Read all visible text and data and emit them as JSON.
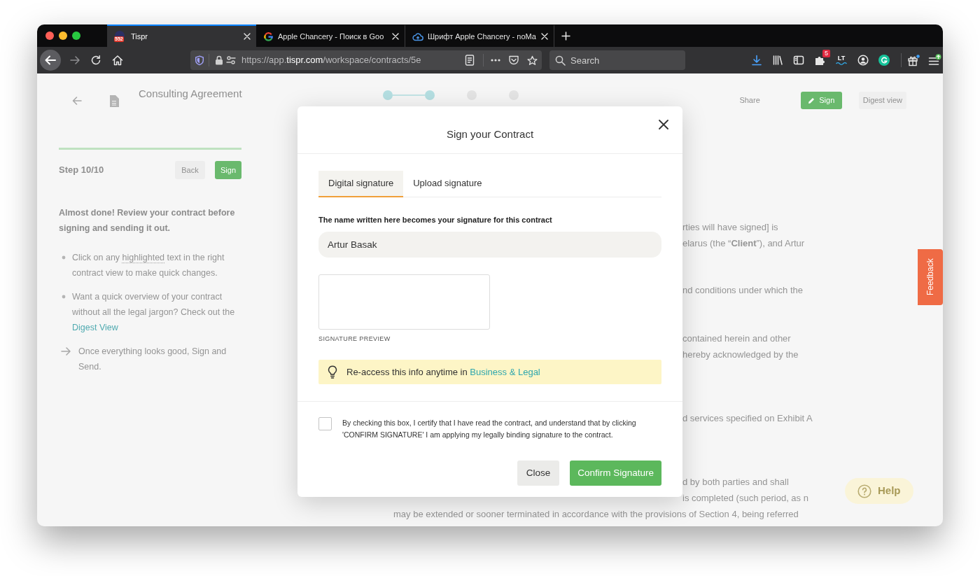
{
  "browser": {
    "tabs": [
      {
        "title": "Tispr",
        "kind": "badge",
        "badge": "552",
        "selected": true
      },
      {
        "title": "Apple Chancery - Поиск в Goo",
        "kind": "search",
        "selected": false
      },
      {
        "title": "Шрифт Apple Chancery - noMa",
        "kind": "cloud",
        "selected": false
      }
    ],
    "address": {
      "scheme": "https://app.",
      "domain": "tispr.com",
      "path": "/workspace/contracts/5e"
    },
    "search": {
      "placeholder": "Search"
    },
    "extensions": {
      "badge": "5",
      "label": "LT"
    }
  },
  "page": {
    "header": {
      "title": "Consulting Agreement",
      "steps": [
        {
          "completed": true
        },
        {
          "completed": true
        },
        {
          "completed": false
        },
        {
          "completed": false
        }
      ],
      "actions": [
        {
          "label": "Share",
          "kind": "plain"
        },
        {
          "label": "Sign",
          "kind": "primary"
        },
        {
          "label": "Digest view",
          "kind": "outline"
        }
      ]
    },
    "sidebar": {
      "progress": {
        "level": 1
      },
      "step": "Step 10/10",
      "buttons": [
        {
          "label": "Back",
          "kind": "secondary"
        },
        {
          "label": "Sign",
          "kind": "primary"
        }
      ],
      "intro": "Almost done! Review your contract before signing and sending it out.",
      "tips": [
        {
          "kind": "bullet",
          "parts": [
            {
              "kind": "plain",
              "text": "Click on any "
            },
            {
              "kind": "highlight",
              "text": "highlighted"
            },
            {
              "kind": "plain",
              "text": " text in the right contract view to make quick changes."
            }
          ]
        },
        {
          "kind": "bullet",
          "parts": [
            {
              "kind": "plain",
              "text": "Want a quick overview of your contract without all the legal jargon? Check out the "
            },
            {
              "kind": "link",
              "text": "Digest View"
            }
          ]
        },
        {
          "kind": "arrow",
          "parts": [
            {
              "kind": "plain",
              "text": "Once everything looks good, Sign and Send."
            }
          ]
        }
      ]
    },
    "contract": {
      "paragraphs": [
        {
          "lines": [
            "rties will have signed] is",
            "elarus (the “**Client**”), and Artur"
          ]
        },
        {
          "lines": [
            "nd conditions under which the"
          ]
        },
        {
          "lines": [
            "contained herein and other",
            "hereby acknowledged by the"
          ]
        },
        {
          "lines": [
            "d services specified on Exhibit A"
          ]
        },
        {
          "lines": [
            "d by both parties and shall",
            "is completed (such period, as n"
          ]
        }
      ],
      "tail": "may be extended or sooner terminated in accordance with the provisions of Section 4, being referred"
    },
    "help": {
      "label": "Help"
    },
    "feedback": {
      "label": "Feedback"
    }
  },
  "modal": {
    "title": "Sign your Contract",
    "tabs": [
      {
        "label": "Digital signature",
        "selected": true
      },
      {
        "label": "Upload signature",
        "selected": false
      }
    ],
    "name_field": {
      "label": "The name written here becomes your signature for this contract",
      "value": "Artur Basak"
    },
    "preview": {
      "caption": "SIGNATURE PREVIEW"
    },
    "notice": {
      "text": "Re-access this info anytime in ",
      "link": "Business & Legal"
    },
    "consent": {
      "checked": false,
      "text": "By checking this box, I certify that I have read the contract, and understand that by clicking 'CONFIRM SIGNATURE' I am applying my legally binding signature to the contract."
    },
    "buttons": [
      {
        "label": "Close",
        "kind": "secondary"
      },
      {
        "label": "Confirm Signature",
        "kind": "primary"
      }
    ]
  }
}
